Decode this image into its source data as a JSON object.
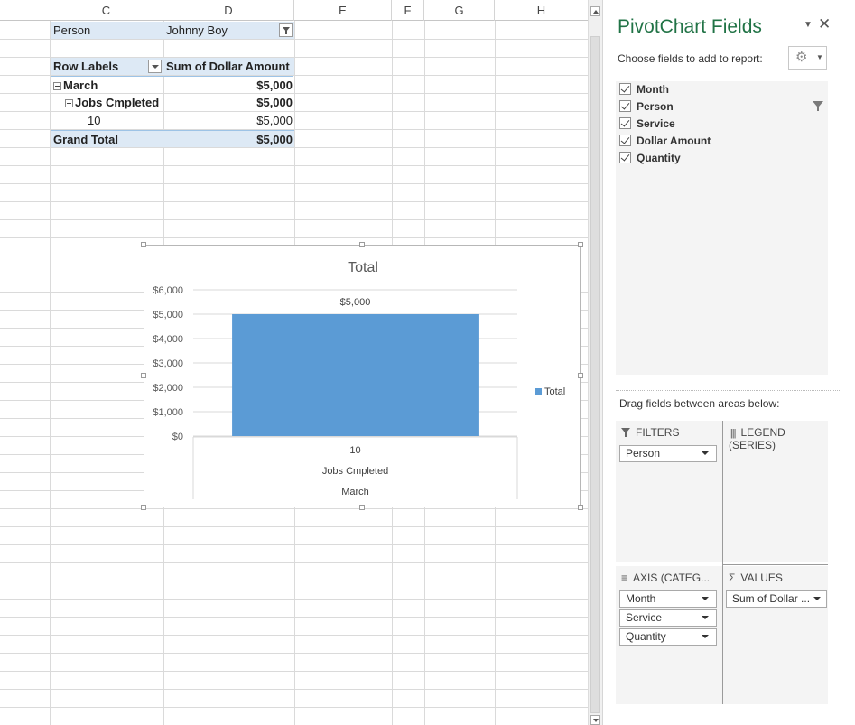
{
  "columns": [
    "C",
    "D",
    "E",
    "F",
    "G",
    "H"
  ],
  "pivot": {
    "filter_label": "Person",
    "filter_value": "Johnny Boy",
    "row_labels_header": "Row Labels",
    "sum_header": "Sum of Dollar Amount",
    "rows": [
      {
        "label": "March",
        "value": "$5,000"
      },
      {
        "label": "Jobs Cmpleted",
        "value": "$5,000"
      },
      {
        "label": "10",
        "value": "$5,000"
      }
    ],
    "grand_total_label": "Grand Total",
    "grand_total_value": "$5,000"
  },
  "chart_data": {
    "type": "bar",
    "title": "Total",
    "categories": [
      "10"
    ],
    "category_levels": [
      "10",
      "Jobs Cmpleted",
      "March"
    ],
    "series": [
      {
        "name": "Total",
        "values": [
          5000
        ],
        "color": "#5b9bd5"
      }
    ],
    "data_labels": [
      "$5,000"
    ],
    "ylim": [
      0,
      6000
    ],
    "yticks": [
      0,
      1000,
      2000,
      3000,
      4000,
      5000,
      6000
    ],
    "ytick_labels": [
      "$0",
      "$1,000",
      "$2,000",
      "$3,000",
      "$4,000",
      "$5,000",
      "$6,000"
    ],
    "grid": true,
    "legend": "right"
  },
  "pane": {
    "title": "PivotChart Fields",
    "choose_label": "Choose fields to add to report:",
    "fields": [
      {
        "label": "Month",
        "checked": true
      },
      {
        "label": "Person",
        "checked": true
      },
      {
        "label": "Service",
        "checked": true
      },
      {
        "label": "Dollar Amount",
        "checked": true
      },
      {
        "label": "Quantity",
        "checked": true
      }
    ],
    "drag_label": "Drag fields between areas below:",
    "filters_label": "FILTERS",
    "legend_label": "LEGEND (SERIES)",
    "axis_label": "AXIS (CATEG...",
    "values_label": "VALUES",
    "filters_items": [
      "Person"
    ],
    "axis_items": [
      "Month",
      "Service",
      "Quantity"
    ],
    "values_items": [
      "Sum of Dollar ..."
    ],
    "accent_color": "#217346"
  }
}
